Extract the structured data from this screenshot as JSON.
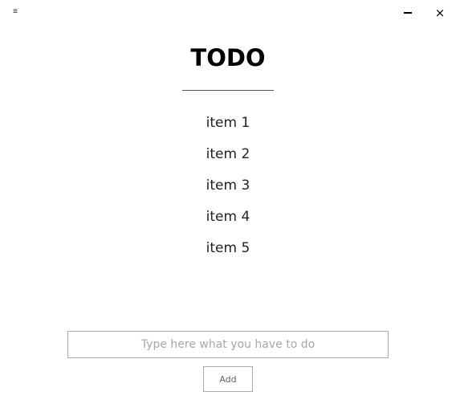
{
  "window": {
    "menu_icon": "≡",
    "minimize_icon": "minimize-icon",
    "close_icon": "×"
  },
  "header": {
    "title": "TODO"
  },
  "todos": [
    {
      "label": "item 1"
    },
    {
      "label": "item 2"
    },
    {
      "label": "item 3"
    },
    {
      "label": "item 4"
    },
    {
      "label": "item 5"
    }
  ],
  "form": {
    "input_value": "",
    "input_placeholder": "Type here what you have to do",
    "add_label": "Add"
  }
}
